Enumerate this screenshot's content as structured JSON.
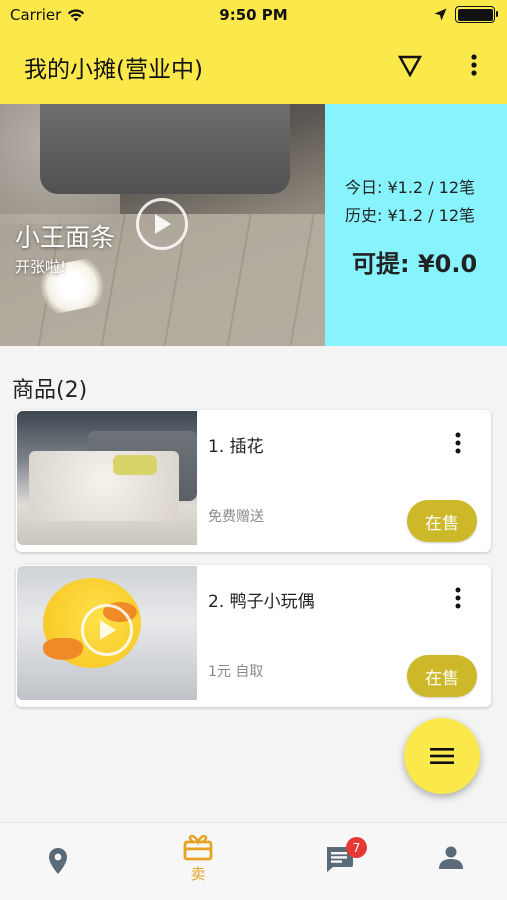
{
  "status_bar": {
    "carrier": "Carrier",
    "time": "9:50 PM"
  },
  "app_bar": {
    "title": "我的小摊(营业中)"
  },
  "banner": {
    "stall_name": "小王面条",
    "subtitle": "开张啦!",
    "today": "今日: ¥1.2 / 12笔",
    "history": "历史: ¥1.2 / 12笔",
    "withdrawable": "可提: ¥0.0"
  },
  "goods": {
    "title": "商品(2)",
    "items": [
      {
        "name": "1. 插花",
        "desc": "免费赠送",
        "status": "在售"
      },
      {
        "name": "2. 鸭子小玩偶",
        "desc": "1元  自取",
        "status": "在售"
      }
    ]
  },
  "bottom_nav": {
    "sell_label": "卖",
    "message_badge": "7"
  },
  "colors": {
    "header": "#fbe94b",
    "stats_panel": "#87f4fd",
    "onsale_button": "#ccb829",
    "active_nav": "#e6a323"
  }
}
